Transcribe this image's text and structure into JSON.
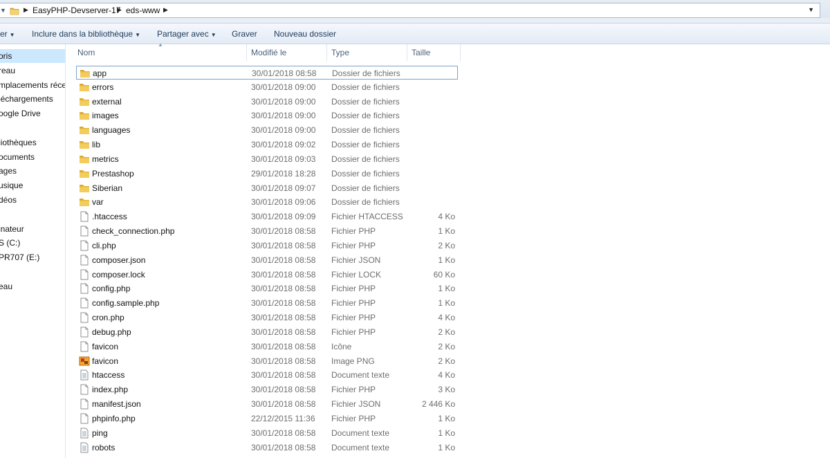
{
  "address": {
    "crumbs": [
      "EasyPHP-Devserver-17",
      "eds-www"
    ]
  },
  "toolbar": {
    "organize": "er",
    "include_library": "Inclure dans la bibliothèque",
    "share_with": "Partager avec",
    "burn": "Graver",
    "new_folder": "Nouveau dossier"
  },
  "nav": {
    "items": [
      {
        "label": "oris",
        "selected": true
      },
      {
        "label": "reau"
      },
      {
        "label": "mplacements récen"
      },
      {
        "label": "léchargements"
      },
      {
        "label": "oogle Drive"
      },
      {
        "label": ""
      },
      {
        "label": "liothèques"
      },
      {
        "label": "ocuments"
      },
      {
        "label": "ages"
      },
      {
        "label": "usique"
      },
      {
        "label": "déos"
      },
      {
        "label": ""
      },
      {
        "label": "inateur"
      },
      {
        "label": "S (C:)"
      },
      {
        "label": "PR707 (E:)"
      },
      {
        "label": ""
      },
      {
        "label": "eau"
      }
    ]
  },
  "columns": {
    "name": "Nom",
    "modified": "Modifié le",
    "type": "Type",
    "size": "Taille"
  },
  "files": [
    {
      "name": "app",
      "date": "30/01/2018 08:58",
      "type": "Dossier de fichiers",
      "size": "",
      "icon": "folder-icon"
    },
    {
      "name": "errors",
      "date": "30/01/2018 09:00",
      "type": "Dossier de fichiers",
      "size": "",
      "icon": "folder-icon"
    },
    {
      "name": "external",
      "date": "30/01/2018 09:00",
      "type": "Dossier de fichiers",
      "size": "",
      "icon": "folder-icon"
    },
    {
      "name": "images",
      "date": "30/01/2018 09:00",
      "type": "Dossier de fichiers",
      "size": "",
      "icon": "folder-icon"
    },
    {
      "name": "languages",
      "date": "30/01/2018 09:00",
      "type": "Dossier de fichiers",
      "size": "",
      "icon": "folder-icon"
    },
    {
      "name": "lib",
      "date": "30/01/2018 09:02",
      "type": "Dossier de fichiers",
      "size": "",
      "icon": "folder-icon"
    },
    {
      "name": "metrics",
      "date": "30/01/2018 09:03",
      "type": "Dossier de fichiers",
      "size": "",
      "icon": "folder-icon"
    },
    {
      "name": "Prestashop",
      "date": "29/01/2018 18:28",
      "type": "Dossier de fichiers",
      "size": "",
      "icon": "folder-icon"
    },
    {
      "name": "Siberian",
      "date": "30/01/2018 09:07",
      "type": "Dossier de fichiers",
      "size": "",
      "icon": "folder-icon"
    },
    {
      "name": "var",
      "date": "30/01/2018 09:06",
      "type": "Dossier de fichiers",
      "size": "",
      "icon": "folder-icon"
    },
    {
      "name": ".htaccess",
      "date": "30/01/2018 09:09",
      "type": "Fichier HTACCESS",
      "size": "4 Ko",
      "icon": "file-icon"
    },
    {
      "name": "check_connection.php",
      "date": "30/01/2018 08:58",
      "type": "Fichier PHP",
      "size": "1 Ko",
      "icon": "file-icon"
    },
    {
      "name": "cli.php",
      "date": "30/01/2018 08:58",
      "type": "Fichier PHP",
      "size": "2 Ko",
      "icon": "file-icon"
    },
    {
      "name": "composer.json",
      "date": "30/01/2018 08:58",
      "type": "Fichier JSON",
      "size": "1 Ko",
      "icon": "file-icon"
    },
    {
      "name": "composer.lock",
      "date": "30/01/2018 08:58",
      "type": "Fichier LOCK",
      "size": "60 Ko",
      "icon": "file-icon"
    },
    {
      "name": "config.php",
      "date": "30/01/2018 08:58",
      "type": "Fichier PHP",
      "size": "1 Ko",
      "icon": "file-icon"
    },
    {
      "name": "config.sample.php",
      "date": "30/01/2018 08:58",
      "type": "Fichier PHP",
      "size": "1 Ko",
      "icon": "file-icon"
    },
    {
      "name": "cron.php",
      "date": "30/01/2018 08:58",
      "type": "Fichier PHP",
      "size": "4 Ko",
      "icon": "file-icon"
    },
    {
      "name": "debug.php",
      "date": "30/01/2018 08:58",
      "type": "Fichier PHP",
      "size": "2 Ko",
      "icon": "file-icon"
    },
    {
      "name": "favicon",
      "date": "30/01/2018 08:58",
      "type": "Icône",
      "size": "2 Ko",
      "icon": "file-icon"
    },
    {
      "name": "favicon",
      "date": "30/01/2018 08:58",
      "type": "Image PNG",
      "size": "2 Ko",
      "icon": "image-icon"
    },
    {
      "name": "htaccess",
      "date": "30/01/2018 08:58",
      "type": "Document texte",
      "size": "4 Ko",
      "icon": "text-file-icon"
    },
    {
      "name": "index.php",
      "date": "30/01/2018 08:58",
      "type": "Fichier PHP",
      "size": "3 Ko",
      "icon": "file-icon"
    },
    {
      "name": "manifest.json",
      "date": "30/01/2018 08:58",
      "type": "Fichier JSON",
      "size": "2 446 Ko",
      "icon": "file-icon"
    },
    {
      "name": "phpinfo.php",
      "date": "22/12/2015 11:36",
      "type": "Fichier PHP",
      "size": "1 Ko",
      "icon": "file-icon"
    },
    {
      "name": "ping",
      "date": "30/01/2018 08:58",
      "type": "Document texte",
      "size": "1 Ko",
      "icon": "text-file-icon"
    },
    {
      "name": "robots",
      "date": "30/01/2018 08:58",
      "type": "Document texte",
      "size": "1 Ko",
      "icon": "text-file-icon"
    }
  ]
}
